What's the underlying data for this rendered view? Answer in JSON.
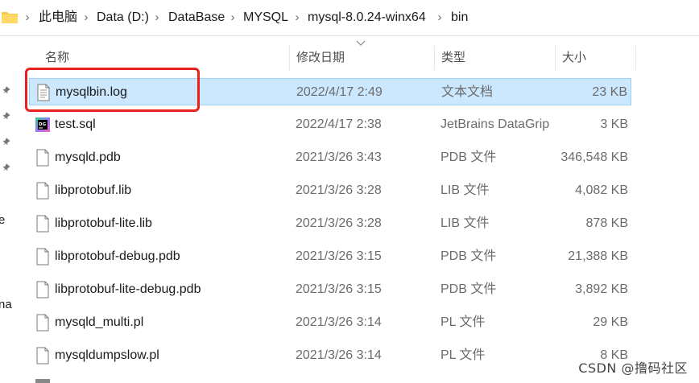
{
  "breadcrumb": [
    "此电脑",
    "Data (D:)",
    "DataBase",
    "MYSQL",
    "mysql-8.0.24-winx64",
    "bin"
  ],
  "columns": {
    "name": "名称",
    "date": "修改日期",
    "type": "类型",
    "size": "大小"
  },
  "nav_fragments": [
    "e",
    "na"
  ],
  "files": [
    {
      "name": "mysqlbin.log",
      "date": "2022/4/17 2:49",
      "type": "文本文档",
      "size": "23 KB",
      "icon": "text-file-icon",
      "selected": true
    },
    {
      "name": "test.sql",
      "date": "2022/4/17 2:38",
      "type": "JetBrains DataGrip",
      "size": "3 KB",
      "icon": "datagrip-icon",
      "selected": false
    },
    {
      "name": "mysqld.pdb",
      "date": "2021/3/26 3:43",
      "type": "PDB 文件",
      "size": "346,548 KB",
      "icon": "file-icon",
      "selected": false
    },
    {
      "name": "libprotobuf.lib",
      "date": "2021/3/26 3:28",
      "type": "LIB 文件",
      "size": "4,082 KB",
      "icon": "file-icon",
      "selected": false
    },
    {
      "name": "libprotobuf-lite.lib",
      "date": "2021/3/26 3:28",
      "type": "LIB 文件",
      "size": "878 KB",
      "icon": "file-icon",
      "selected": false
    },
    {
      "name": "libprotobuf-debug.pdb",
      "date": "2021/3/26 3:15",
      "type": "PDB 文件",
      "size": "21,388 KB",
      "icon": "file-icon",
      "selected": false
    },
    {
      "name": "libprotobuf-lite-debug.pdb",
      "date": "2021/3/26 3:15",
      "type": "PDB 文件",
      "size": "3,892 KB",
      "icon": "file-icon",
      "selected": false
    },
    {
      "name": "mysqld_multi.pl",
      "date": "2021/3/26 3:14",
      "type": "PL 文件",
      "size": "29 KB",
      "icon": "file-icon",
      "selected": false
    },
    {
      "name": "mysqldumpslow.pl",
      "date": "2021/3/26 3:14",
      "type": "PL 文件",
      "size": "8 KB",
      "icon": "file-icon",
      "selected": false
    }
  ],
  "watermark": "CSDN @撸码社区",
  "colors": {
    "selection_bg": "#cce8ff",
    "selection_border": "#99d1ff",
    "highlight": "#e8211a",
    "folder": "#f7c948"
  }
}
